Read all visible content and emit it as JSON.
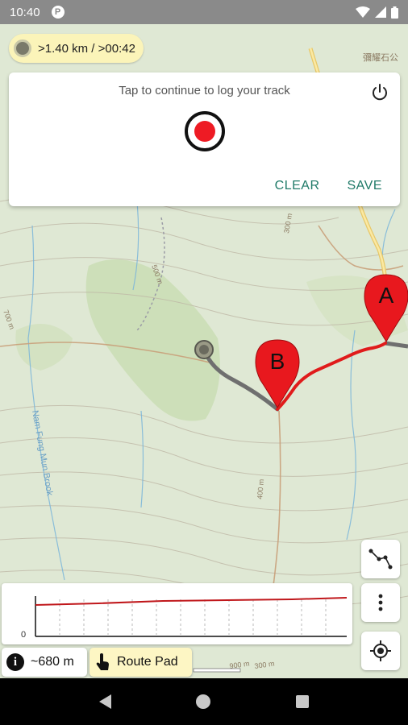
{
  "status_bar": {
    "time": "10:40",
    "app_icon": "p-circle-icon",
    "icons": [
      "wifi-icon",
      "signal-icon",
      "battery-icon"
    ]
  },
  "map": {
    "distance_summary": ">1.40 km / >00:42",
    "contour_labels": [
      "500 m",
      "300 m",
      "400 m",
      "700 m",
      "900 m",
      "300 m"
    ],
    "place_labels": [
      "彌耀石公",
      "Nam Fung Mun Brook"
    ],
    "markers": [
      {
        "label": "A"
      },
      {
        "label": "B"
      }
    ],
    "colors": {
      "track": "#e01b1b",
      "route": "#6f6f6f",
      "marker": "#e8181e"
    }
  },
  "track_card": {
    "message": "Tap to continue to log your track",
    "clear_label": "CLEAR",
    "save_label": "SAVE",
    "accent": "#1f7a68"
  },
  "elevation_panel": {
    "zero_label": "0",
    "line_color": "#c0171b"
  },
  "bottom": {
    "distance": "~680 m",
    "route_pad_label": "Route Pad"
  },
  "map_buttons": [
    "route-line-icon",
    "more-vert-icon",
    "gps-target-icon"
  ]
}
